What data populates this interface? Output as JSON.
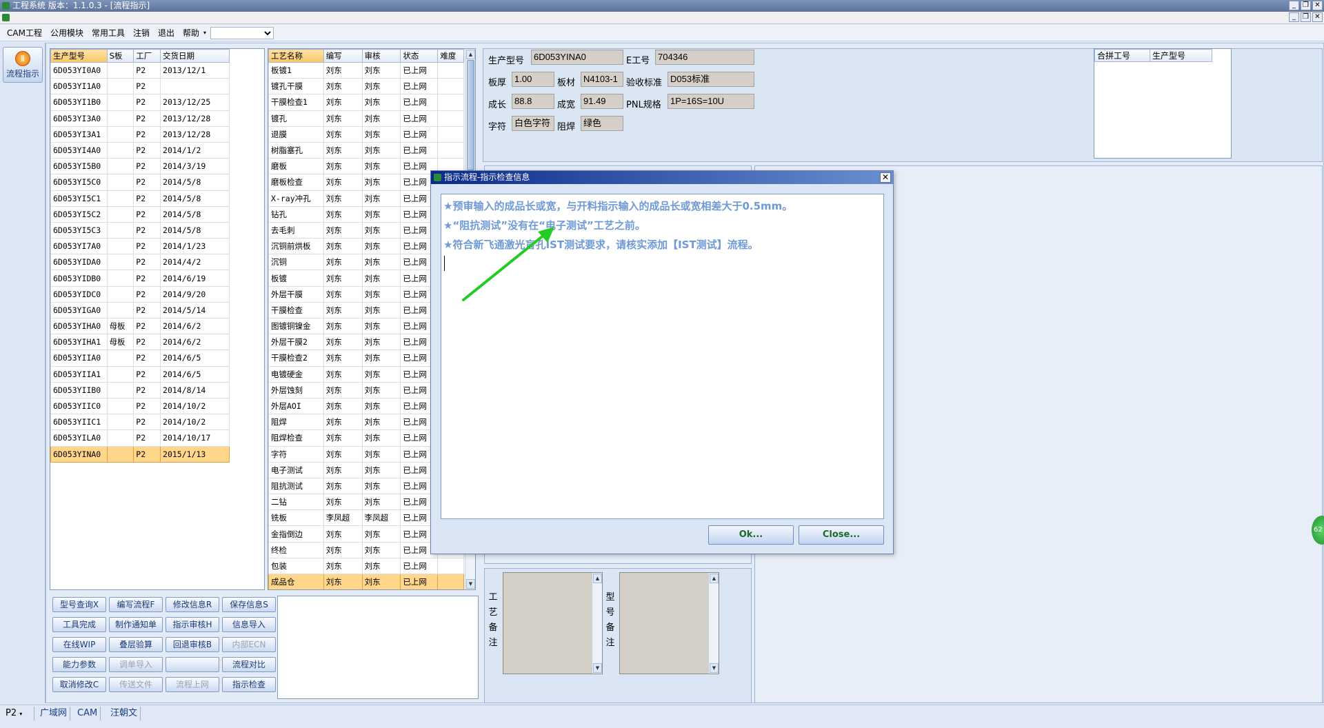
{
  "window": {
    "title": "工程系统    版本：1.1.0.3 - [流程指示]",
    "controls": [
      "_",
      "❐",
      "✕"
    ]
  },
  "menu": {
    "items": [
      "CAM工程",
      "公用模块",
      "常用工具",
      "注销",
      "退出",
      "帮助"
    ],
    "dropdown_value": ""
  },
  "leftnav": {
    "button_label": "流程指示"
  },
  "products_table": {
    "columns": [
      "生产型号",
      "S板",
      "工厂",
      "交货日期"
    ],
    "rows": [
      [
        "6D053YI0A0",
        "",
        "P2",
        "2013/12/1"
      ],
      [
        "6D053YI1A0",
        "",
        "P2",
        ""
      ],
      [
        "6D053YI1B0",
        "",
        "P2",
        "2013/12/25"
      ],
      [
        "6D053YI3A0",
        "",
        "P2",
        "2013/12/28"
      ],
      [
        "6D053YI3A1",
        "",
        "P2",
        "2013/12/28"
      ],
      [
        "6D053YI4A0",
        "",
        "P2",
        "2014/1/2"
      ],
      [
        "6D053YI5B0",
        "",
        "P2",
        "2014/3/19"
      ],
      [
        "6D053YI5C0",
        "",
        "P2",
        "2014/5/8"
      ],
      [
        "6D053YI5C1",
        "",
        "P2",
        "2014/5/8"
      ],
      [
        "6D053YI5C2",
        "",
        "P2",
        "2014/5/8"
      ],
      [
        "6D053YI5C3",
        "",
        "P2",
        "2014/5/8"
      ],
      [
        "6D053YI7A0",
        "",
        "P2",
        "2014/1/23"
      ],
      [
        "6D053YIDA0",
        "",
        "P2",
        "2014/4/2"
      ],
      [
        "6D053YIDB0",
        "",
        "P2",
        "2014/6/19"
      ],
      [
        "6D053YIDC0",
        "",
        "P2",
        "2014/9/20"
      ],
      [
        "6D053YIGA0",
        "",
        "P2",
        "2014/5/14"
      ],
      [
        "6D053YIHA0",
        "母板",
        "P2",
        "2014/6/2"
      ],
      [
        "6D053YIHA1",
        "母板",
        "P2",
        "2014/6/2"
      ],
      [
        "6D053YIIA0",
        "",
        "P2",
        "2014/6/5"
      ],
      [
        "6D053YIIA1",
        "",
        "P2",
        "2014/6/5"
      ],
      [
        "6D053YIIB0",
        "",
        "P2",
        "2014/8/14"
      ],
      [
        "6D053YIIC0",
        "",
        "P2",
        "2014/10/2"
      ],
      [
        "6D053YIIC1",
        "",
        "P2",
        "2014/10/2"
      ],
      [
        "6D053YILA0",
        "",
        "P2",
        "2014/10/17"
      ],
      [
        "6D053YINA0",
        "",
        "P2",
        "2015/1/13"
      ]
    ],
    "selected_index": 24
  },
  "process_table": {
    "columns": [
      "工艺名称",
      "编写",
      "审核",
      "状态",
      "难度"
    ],
    "rows": [
      [
        "板镀1",
        "刘东",
        "刘东",
        "已上网",
        ""
      ],
      [
        "镀孔干膜",
        "刘东",
        "刘东",
        "已上网",
        ""
      ],
      [
        "干膜检查1",
        "刘东",
        "刘东",
        "已上网",
        ""
      ],
      [
        "镀孔",
        "刘东",
        "刘东",
        "已上网",
        ""
      ],
      [
        "退膜",
        "刘东",
        "刘东",
        "已上网",
        ""
      ],
      [
        "树脂塞孔",
        "刘东",
        "刘东",
        "已上网",
        ""
      ],
      [
        "磨板",
        "刘东",
        "刘东",
        "已上网",
        ""
      ],
      [
        "磨板检查",
        "刘东",
        "刘东",
        "已上网",
        ""
      ],
      [
        "X-ray冲孔",
        "刘东",
        "刘东",
        "已上网",
        ""
      ],
      [
        "钻孔",
        "刘东",
        "刘东",
        "已上网",
        ""
      ],
      [
        "去毛刺",
        "刘东",
        "刘东",
        "已上网",
        ""
      ],
      [
        "沉铜前烘板",
        "刘东",
        "刘东",
        "已上网",
        ""
      ],
      [
        "沉铜",
        "刘东",
        "刘东",
        "已上网",
        ""
      ],
      [
        "板镀",
        "刘东",
        "刘东",
        "已上网",
        ""
      ],
      [
        "外层干膜",
        "刘东",
        "刘东",
        "已上网",
        ""
      ],
      [
        "干膜检查",
        "刘东",
        "刘东",
        "已上网",
        ""
      ],
      [
        "图镀铜镍金",
        "刘东",
        "刘东",
        "已上网",
        ""
      ],
      [
        "外层干膜2",
        "刘东",
        "刘东",
        "已上网",
        ""
      ],
      [
        "干膜检查2",
        "刘东",
        "刘东",
        "已上网",
        ""
      ],
      [
        "电镀硬金",
        "刘东",
        "刘东",
        "已上网",
        ""
      ],
      [
        "外层蚀刻",
        "刘东",
        "刘东",
        "已上网",
        ""
      ],
      [
        "外层AOI",
        "刘东",
        "刘东",
        "已上网",
        ""
      ],
      [
        "阻焊",
        "刘东",
        "刘东",
        "已上网",
        ""
      ],
      [
        "阻焊检查",
        "刘东",
        "刘东",
        "已上网",
        ""
      ],
      [
        "字符",
        "刘东",
        "刘东",
        "已上网",
        ""
      ],
      [
        "电子测试",
        "刘东",
        "刘东",
        "已上网",
        ""
      ],
      [
        "阻抗测试",
        "刘东",
        "刘东",
        "已上网",
        ""
      ],
      [
        "二钻",
        "刘东",
        "刘东",
        "已上网",
        ""
      ],
      [
        "铣板",
        "李凤超",
        "李凤超",
        "已上网",
        ""
      ],
      [
        "金指倒边",
        "刘东",
        "刘东",
        "已上网",
        ""
      ],
      [
        "终检",
        "刘东",
        "刘东",
        "已上网",
        ""
      ],
      [
        "包装",
        "刘东",
        "刘东",
        "已上网",
        ""
      ],
      [
        "成品仓",
        "刘东",
        "刘东",
        "已上网",
        ""
      ]
    ],
    "selected_index": 32
  },
  "buttons": [
    [
      "型号查询X",
      "编写流程F",
      "修改信息R",
      "保存信息S"
    ],
    [
      "工具完成",
      "制作通知单",
      "指示审核H",
      "信息导入"
    ],
    [
      "在线WIP",
      "叠层验算",
      "回退审核B",
      "内部ECN"
    ],
    [
      "能力参数",
      "调单导入",
      "",
      "流程对比"
    ],
    [
      "取消修改C",
      "传送文件",
      "流程上网",
      "指示检查"
    ]
  ],
  "disabled_buttons": [
    "内部ECN",
    "调单导入",
    "传送文件",
    "流程上网"
  ],
  "info": {
    "prod_label": "生产型号",
    "prod_value": "6D053YINA0",
    "eno_label": "E工号",
    "eno_value": "704346",
    "thick_label": "板厚",
    "thick_value": "1.00",
    "mat_label": "板材",
    "mat_value": "N4103-1",
    "std_label": "验收标准",
    "std_value": "D053标准",
    "len_label": "成长",
    "len_value": "88.8",
    "wid_label": "成宽",
    "wid_value": "91.49",
    "pnl_label": "PNL规格",
    "pnl_value": "1P=16S=10U",
    "char_label": "字符",
    "char_value": "白色字符",
    "mask_label": "阻焊",
    "mask_value": "绿色"
  },
  "merge_table": {
    "columns": [
      "合拼工号",
      "生产型号"
    ]
  },
  "notes": {
    "process_note_label": "工艺备注",
    "model_note_label": "型号备注"
  },
  "statusbar": {
    "factory": "P2",
    "network": "广域网",
    "module": "CAM",
    "user": "汪朝文"
  },
  "dialog": {
    "title": "指示流程-指示检查信息",
    "messages": [
      "★预审输入的成品长或宽，与开料指示输入的成品长或宽相差大于0.5mm。",
      "★“阻抗测试”没有在“电子测试”工艺之前。",
      "★符合新飞通激光盲孔IST测试要求，请核实添加【IST测试】流程。"
    ],
    "ok_label": "Ok...",
    "close_label": "Close..."
  },
  "edge_badge": "62",
  "colors": {
    "accent": "#6f9ad6",
    "selection": "#ffd68a",
    "arrow": "#22cc22"
  }
}
